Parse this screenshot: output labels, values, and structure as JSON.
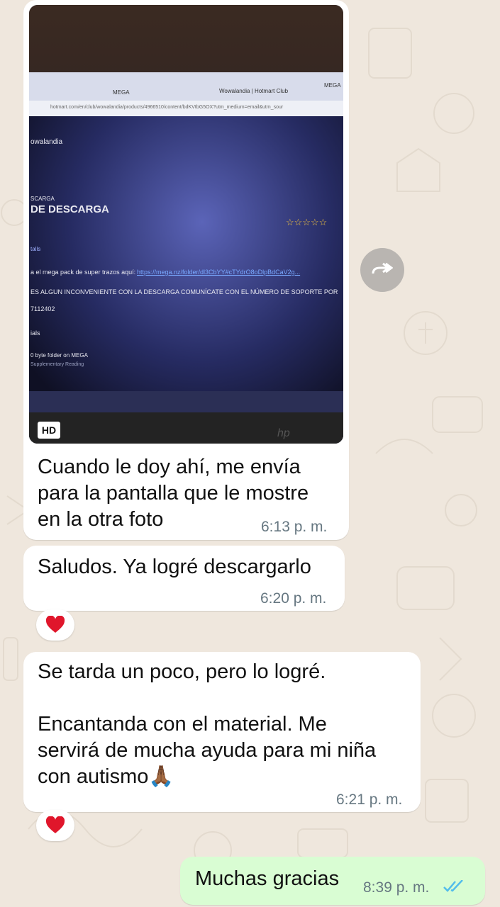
{
  "messages": [
    {
      "text": "Cuando le doy ahí, me envía\npara la pantalla que le mostre\nen la otra foto",
      "time": "6:13 p. m."
    },
    {
      "text": "Saludos. Ya logré descargarlo",
      "time": "6:20 p. m.",
      "reaction": "❤️"
    },
    {
      "text": "Se tarda un poco, pero lo logré.\n\nEncantanda con el material. Me\nservirá de mucha ayuda para mi niña\ncon autismo🙏🏾",
      "time": "6:21 p. m.",
      "reaction": "❤️"
    },
    {
      "text": "Muchas gracias",
      "time": "8:39 p. m.",
      "status": "read"
    }
  ],
  "photo": {
    "hd_label": "HD",
    "tab1": "MEGA",
    "tab2": "Wowalandia | Hotmart Club",
    "tab3": "MEGA",
    "url": "hotmart.com/en/club/wowalandia/products/4966510/content/bdKVtbG5OX?utm_medium=email&utm_sour",
    "site": "owalandia",
    "heading_small": "SCARGA",
    "heading": "DE DESCARGA",
    "stars": "☆☆☆☆☆",
    "details": "talls",
    "line1_text": "a el mega pack de super trazos aquí:",
    "line1_link": "https://mega.nz/folder/dl3CbYY#cTYdrO8oDlpBdCaV2g...",
    "line2": "ES ALGUN INCONVENIENTE CON LA DESCARGA COMUNÍCATE CON EL NÚMERO DE SOPORTE POR",
    "line3": "7112402",
    "materials": "ials",
    "file": "0 byte folder on MEGA",
    "file_sub": "Supplementary Reading",
    "brand": "hp"
  },
  "colors": {
    "bg": "#efe7dd",
    "incoming": "#ffffff",
    "outgoing": "#d9fdd3",
    "read_ticks": "#53bdeb",
    "time": "#667781"
  }
}
